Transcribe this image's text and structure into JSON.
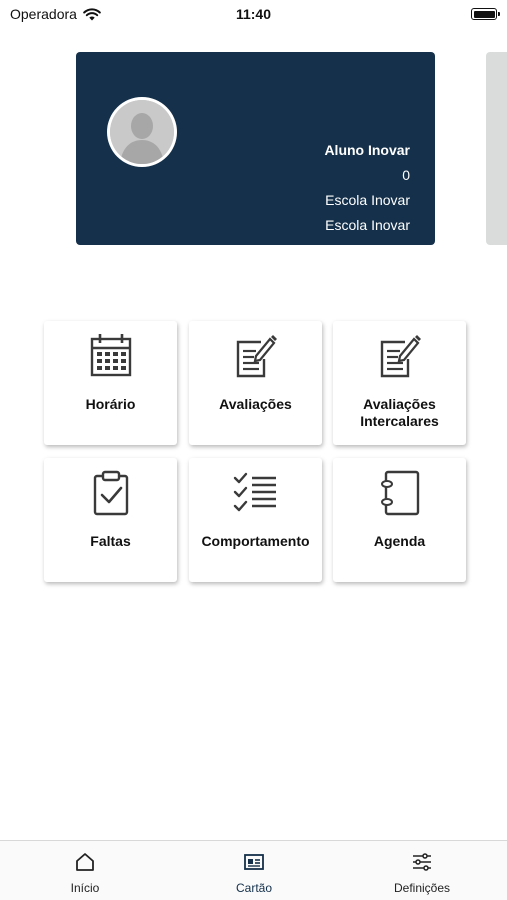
{
  "status_bar": {
    "carrier": "Operadora",
    "time": "11:40"
  },
  "student": {
    "name": "Aluno Inovar",
    "number": "0",
    "school": "Escola Inovar",
    "school2": "Escola Inovar"
  },
  "menu": [
    {
      "label": "Horário",
      "icon": "calendar-icon"
    },
    {
      "label": "Avaliações",
      "icon": "edit-document-icon"
    },
    {
      "label": "Avaliações Intercalares",
      "icon": "edit-document-icon"
    },
    {
      "label": "Faltas",
      "icon": "clipboard-check-icon"
    },
    {
      "label": "Comportamento",
      "icon": "checklist-icon"
    },
    {
      "label": "Agenda",
      "icon": "notebook-icon"
    }
  ],
  "tabs": [
    {
      "label": "Início",
      "icon": "home-icon"
    },
    {
      "label": "Cartão",
      "icon": "id-card-icon",
      "active": true
    },
    {
      "label": "Definições",
      "icon": "settings-sliders-icon"
    }
  ],
  "colors": {
    "card_bg": "#14304a",
    "accent": "#14304a",
    "icon": "#3a3a3a"
  }
}
